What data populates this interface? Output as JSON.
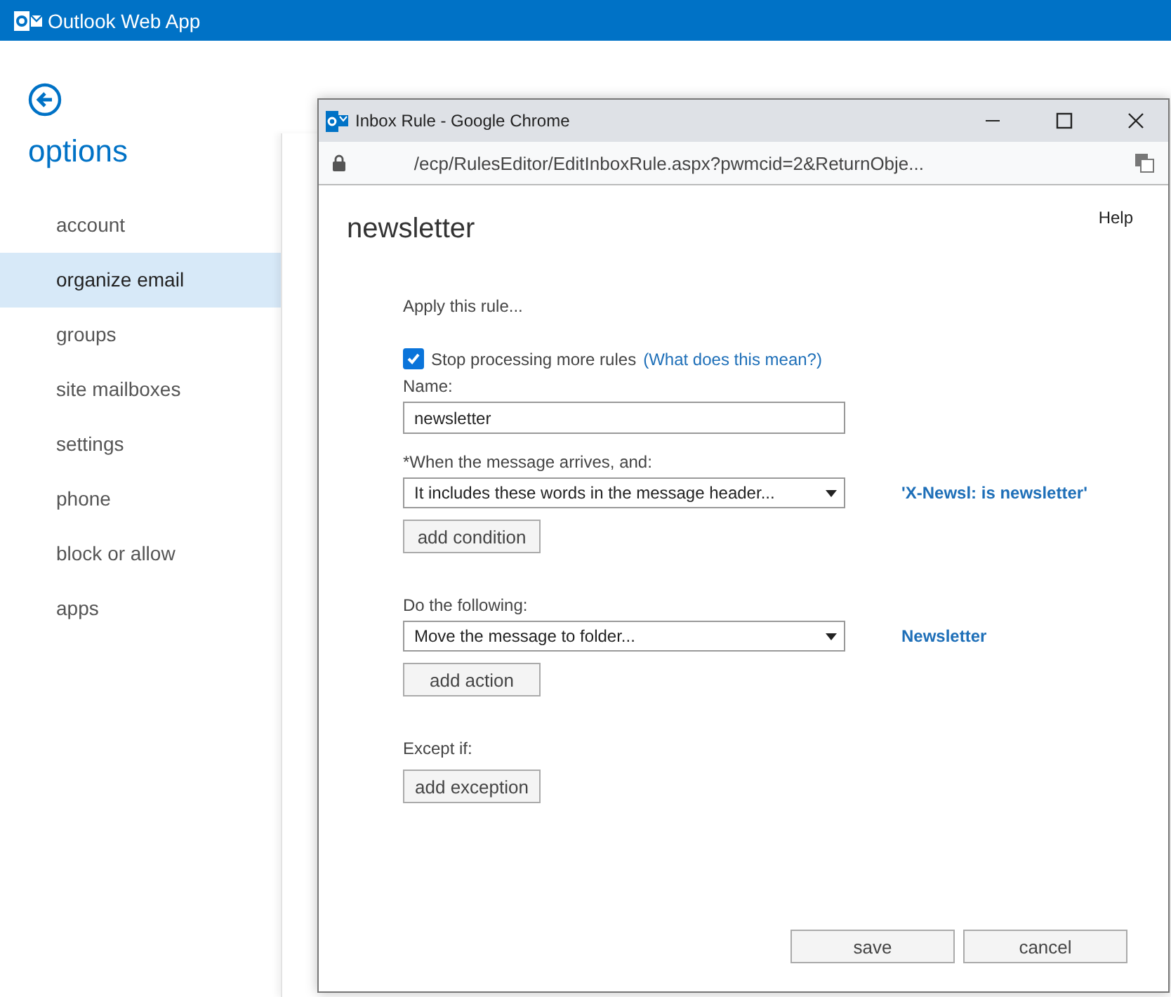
{
  "app_bar": {
    "title": "Outlook Web App"
  },
  "sidebar": {
    "heading": "options",
    "items": [
      {
        "label": "account",
        "selected": false
      },
      {
        "label": "organize email",
        "selected": true
      },
      {
        "label": "groups",
        "selected": false
      },
      {
        "label": "site mailboxes",
        "selected": false
      },
      {
        "label": "settings",
        "selected": false
      },
      {
        "label": "phone",
        "selected": false
      },
      {
        "label": "block or allow",
        "selected": false
      },
      {
        "label": "apps",
        "selected": false
      }
    ]
  },
  "popup": {
    "window_title": "Inbox Rule - Google Chrome",
    "url": "/ecp/RulesEditor/EditInboxRule.aspx?pwmcid=2&ReturnObje...",
    "heading": "newsletter",
    "help": "Help",
    "intro": "Apply this rule...",
    "stop_processing": {
      "label": "Stop processing more rules",
      "link": "(What does this mean?)",
      "checked": true
    },
    "name": {
      "label": "Name:",
      "value": "newsletter"
    },
    "sections": [
      {
        "label": "*When the message arrives, and:",
        "select": "It includes these words in the message header...",
        "detail": "'X-Newsl: is newsletter'",
        "button": "add condition"
      },
      {
        "label": "Do the following:",
        "select": "Move the message to folder...",
        "detail": "Newsletter",
        "button": "add action"
      },
      {
        "label": "Except if:",
        "button": "add exception"
      }
    ],
    "buttons": [
      "save",
      "cancel"
    ]
  }
}
